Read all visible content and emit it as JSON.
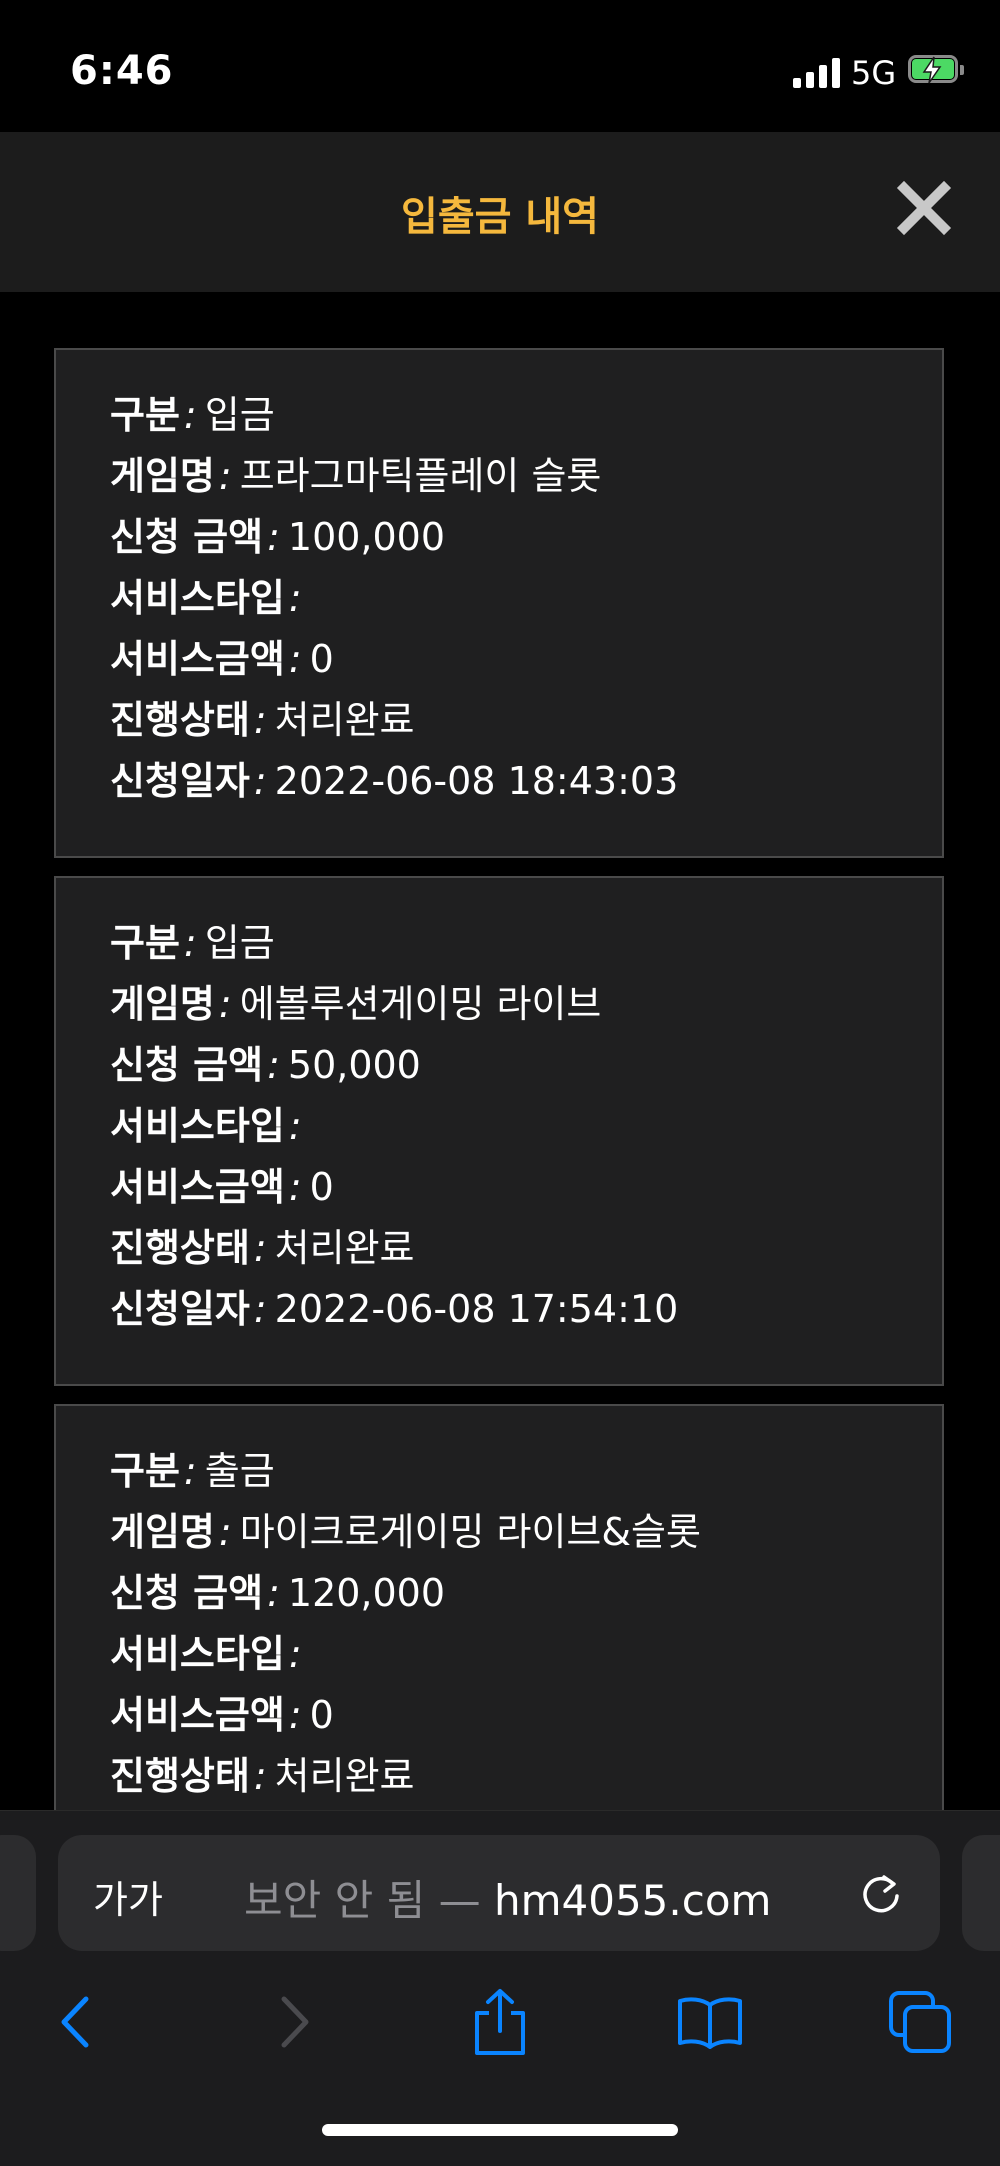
{
  "status_bar": {
    "time": "6:46",
    "network": "5G"
  },
  "header": {
    "title": "입출금 내역"
  },
  "labels": {
    "type": "구분",
    "game": "게임명",
    "amount": "신청 금액",
    "service_type": "서비스타입",
    "service_amount": "서비스금액",
    "status": "진행상태",
    "date": "신청일자"
  },
  "records": [
    {
      "type": "입금",
      "game": "프라그마틱플레이 슬롯",
      "amount": "100,000",
      "service_type": "",
      "service_amount": "0",
      "status": "처리완료",
      "date": "2022-06-08 18:43:03"
    },
    {
      "type": "입금",
      "game": "에볼루션게이밍 라이브",
      "amount": "50,000",
      "service_type": "",
      "service_amount": "0",
      "status": "처리완료",
      "date": "2022-06-08 17:54:10"
    },
    {
      "type": "출금",
      "game": "마이크로게이밍 라이브&슬롯",
      "amount": "120,000",
      "service_type": "",
      "service_amount": "0",
      "status": "처리완료"
    }
  ],
  "browser": {
    "text_size": "가가",
    "insecure_label": "보안 안 됨 —",
    "domain": "hm4055.com"
  },
  "colors": {
    "accent": "#f5b83d",
    "link": "#0a84ff",
    "card_bg": "#1f1f20"
  },
  "icons": [
    "back-icon",
    "forward-icon",
    "share-icon",
    "bookmarks-icon",
    "tabs-icon",
    "reload-icon",
    "close-icon"
  ]
}
